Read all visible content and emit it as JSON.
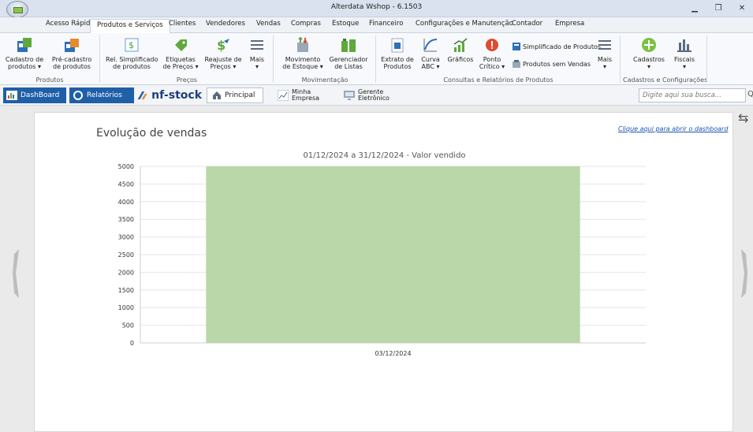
{
  "window": {
    "title": "Alterdata Wshop - 6.1503"
  },
  "menu": {
    "tabs": [
      "Acesso Rápido",
      "Produtos e Serviços",
      "Clientes",
      "Vendedores",
      "Vendas",
      "Compras",
      "Estoque",
      "Financeiro",
      "Configurações e Manutenção",
      "Contador",
      "Empresa"
    ],
    "active": "Produtos e Serviços"
  },
  "ribbon": {
    "groups": {
      "produtos": "Produtos",
      "precos": "Preços",
      "movimentacao": "Movimentação",
      "consultas": "Consultas e Relatórios de Produtos",
      "cadastros": "Cadastros e Configurações"
    },
    "buttons": {
      "cadastro_produtos": [
        "Cadastro de",
        "produtos ▾"
      ],
      "pre_cadastro": [
        "Pré-cadastro",
        "de produtos"
      ],
      "rel_simplificado": [
        "Rel. Simplificado",
        "de produtos"
      ],
      "etiquetas": [
        "Etiquetas",
        "de Preços ▾"
      ],
      "reajuste": [
        "Reajuste de",
        "Preços ▾"
      ],
      "mais1": [
        "Mais",
        "▾"
      ],
      "movimento": [
        "Movimento",
        "de Estoque ▾"
      ],
      "gerenciador": [
        "Gerenciador",
        "de Listas"
      ],
      "extrato": [
        "Extrato de",
        "Produtos"
      ],
      "curva": [
        "Curva",
        "ABC ▾"
      ],
      "graficos": [
        "Gráficos",
        ""
      ],
      "ponto": [
        "Ponto",
        "Crítico ▾"
      ],
      "simplificado": "Simplificado de Produtos",
      "sem_vendas": "Produtos sem Vendas",
      "mais2": [
        "Mais",
        "▾"
      ],
      "cadastros": [
        "Cadastros",
        "▾"
      ],
      "fiscais": [
        "Fiscais",
        "▾"
      ]
    }
  },
  "nav": {
    "dashboard": "DashBoard",
    "relatorios": "Relatórios",
    "nfstock": "nf-stock",
    "principal": "Principal",
    "minha": [
      "Minha",
      "Empresa"
    ],
    "gerente": [
      "Gerente",
      "Eletrônico"
    ],
    "search_placeholder": "Digite aqui sua busca..."
  },
  "dashboard": {
    "title": "Evolução de vendas",
    "link": "Clique aqui para abrir o dashboard"
  },
  "chart_data": {
    "type": "bar",
    "title": "01/12/2024 a 31/12/2024 - Valor vendido",
    "categories": [
      "03/12/2024"
    ],
    "values": [
      5000
    ],
    "ylim": [
      0,
      5000
    ],
    "yticks": [
      0,
      500,
      1000,
      1500,
      2000,
      2500,
      3000,
      3500,
      4000,
      4500,
      5000
    ],
    "bar_color": "#b9d7a8",
    "grid": true,
    "xlabel": "",
    "ylabel": ""
  }
}
